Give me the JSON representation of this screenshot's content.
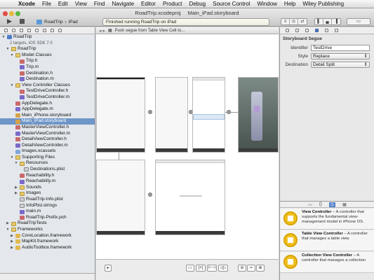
{
  "menubar": {
    "app": "Xcode",
    "items": [
      "File",
      "Edit",
      "View",
      "Find",
      "Navigate",
      "Editor",
      "Product",
      "Debug",
      "Source Control",
      "Window",
      "Help",
      "Wiley Publishing"
    ]
  },
  "toolbar": {
    "project_tab": "RoadTrip.xcodeproj",
    "file_tab": "Main_iPad.storyboard",
    "scheme": "RoadTrip",
    "destination": "iPad",
    "status": "Finished running RoadTrip on iPad"
  },
  "navigator": {
    "items": [
      {
        "label": "RoadTrip",
        "level": 0,
        "icon": "project",
        "disclosure": "▼"
      },
      {
        "label": "2 targets, iOS SDK 7.0",
        "level": 1,
        "icon": "",
        "disclosure": "",
        "sub": true
      },
      {
        "label": "RoadTrip",
        "level": 1,
        "icon": "folder",
        "disclosure": "▼"
      },
      {
        "label": "Model Classes",
        "level": 2,
        "icon": "folder",
        "disclosure": "▼"
      },
      {
        "label": "Trip.h",
        "level": 3,
        "icon": "h",
        "disclosure": ""
      },
      {
        "label": "Trip.m",
        "level": 3,
        "icon": "m",
        "disclosure": ""
      },
      {
        "label": "Destination.h",
        "level": 3,
        "icon": "h",
        "disclosure": ""
      },
      {
        "label": "Destination.m",
        "level": 3,
        "icon": "m",
        "disclosure": ""
      },
      {
        "label": "View Controller Classes",
        "level": 2,
        "icon": "folder",
        "disclosure": "▼"
      },
      {
        "label": "TestDriveController.h",
        "level": 3,
        "icon": "h",
        "disclosure": ""
      },
      {
        "label": "TestDriveController.m",
        "level": 3,
        "icon": "m",
        "disclosure": ""
      },
      {
        "label": "AppDelegate.h",
        "level": 2,
        "icon": "h",
        "disclosure": ""
      },
      {
        "label": "AppDelegate.m",
        "level": 2,
        "icon": "m",
        "disclosure": ""
      },
      {
        "label": "Main_iPhone.storyboard",
        "level": 2,
        "icon": "story",
        "disclosure": ""
      },
      {
        "label": "Main_iPad.storyboard",
        "level": 2,
        "icon": "story",
        "disclosure": "",
        "selected": true
      },
      {
        "label": "MasterViewController.h",
        "level": 2,
        "icon": "h",
        "disclosure": ""
      },
      {
        "label": "MasterViewController.m",
        "level": 2,
        "icon": "m",
        "disclosure": ""
      },
      {
        "label": "DetailViewController.h",
        "level": 2,
        "icon": "h",
        "disclosure": ""
      },
      {
        "label": "DetailViewController.m",
        "level": 2,
        "icon": "m",
        "disclosure": ""
      },
      {
        "label": "Images.xcassets",
        "level": 2,
        "icon": "assets",
        "disclosure": ""
      },
      {
        "label": "Supporting Files",
        "level": 2,
        "icon": "folder",
        "disclosure": "▼"
      },
      {
        "label": "Resources",
        "level": 3,
        "icon": "folder",
        "disclosure": "▼"
      },
      {
        "label": "Destinations.plist",
        "level": 4,
        "icon": "plist",
        "disclosure": ""
      },
      {
        "label": "Reachability.h",
        "level": 3,
        "icon": "h",
        "disclosure": ""
      },
      {
        "label": "Reachability.m",
        "level": 3,
        "icon": "m",
        "disclosure": ""
      },
      {
        "label": "Sounds",
        "level": 3,
        "icon": "folder",
        "disclosure": "▶"
      },
      {
        "label": "Images",
        "level": 3,
        "icon": "folder",
        "disclosure": "▶"
      },
      {
        "label": "RoadTrip-Info.plist",
        "level": 3,
        "icon": "plist",
        "disclosure": ""
      },
      {
        "label": "InfoPlist.strings",
        "level": 3,
        "icon": "plist",
        "disclosure": ""
      },
      {
        "label": "main.m",
        "level": 3,
        "icon": "m",
        "disclosure": ""
      },
      {
        "label": "RoadTrip-Prefix.pch",
        "level": 3,
        "icon": "h",
        "disclosure": ""
      },
      {
        "label": "RoadTripTests",
        "level": 1,
        "icon": "folder",
        "disclosure": "▶"
      },
      {
        "label": "Frameworks",
        "level": 1,
        "icon": "folder",
        "disclosure": "▼"
      },
      {
        "label": "CoreLocation.framework",
        "level": 2,
        "icon": "fw",
        "disclosure": "▶"
      },
      {
        "label": "MapKit.framework",
        "level": 2,
        "icon": "fw",
        "disclosure": "▶"
      },
      {
        "label": "AudioToolbox.framework",
        "level": 2,
        "icon": "fw",
        "disclosure": "▶"
      }
    ]
  },
  "editor": {
    "jumpbar_segue": "Push segue from Table View Cell to..."
  },
  "inspector": {
    "section_title": "Storyboard Segue",
    "identifier_label": "Identifier",
    "identifier_value": "TestDrive",
    "style_label": "Style",
    "style_value": "Replace",
    "destination_label": "Destination",
    "destination_value": "Detail Split"
  },
  "library": {
    "tabs": [
      "{}",
      "◎",
      "▦"
    ],
    "items": [
      {
        "title": "View Controller",
        "desc": "A controller that supports the fundamental view-management model in iPhone OS."
      },
      {
        "title": "Table View Controller",
        "desc": "A controller that manages a table view."
      },
      {
        "title": "Collection View Controller",
        "desc": "A controller that manages a collection"
      }
    ]
  },
  "colors": {
    "selection": "#6e96c8",
    "library_icon": "#f0c020"
  }
}
